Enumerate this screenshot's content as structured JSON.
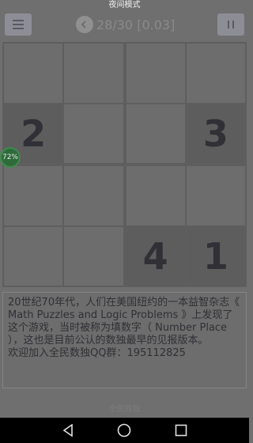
{
  "status_bar": {
    "title": "夜间模式"
  },
  "toolbar": {
    "progress": "28/30 [0.03]",
    "menu_icon": "hamburger-menu-icon",
    "pause_icon": "pause-icon",
    "back_icon": "back-arrow-icon"
  },
  "board": {
    "size": 4,
    "cells": [
      [
        "",
        "",
        "",
        ""
      ],
      [
        "2",
        "",
        "",
        "3"
      ],
      [
        "",
        "",
        "",
        ""
      ],
      [
        "",
        "",
        "4",
        "1"
      ]
    ]
  },
  "badge": {
    "percent": "72%"
  },
  "info": {
    "paragraph": "20世纪70年代，人们在美国纽约的一本益智杂志《 Math Puzzles and Logic Problems 》上发现了这个游戏，当时被称为填数字（ Number Place ），这也是目前公认的数独最早的见报版本。",
    "qq_group": "欢迎加入全民数独QQ群：195112825"
  },
  "footer": {
    "link": "全民数独"
  },
  "colors": {
    "background": "#6f6f6f",
    "cell": "#6d6d6d",
    "given_cell": "#5d5d5d",
    "digit": "#303036",
    "badge": "#2e6b3a"
  }
}
